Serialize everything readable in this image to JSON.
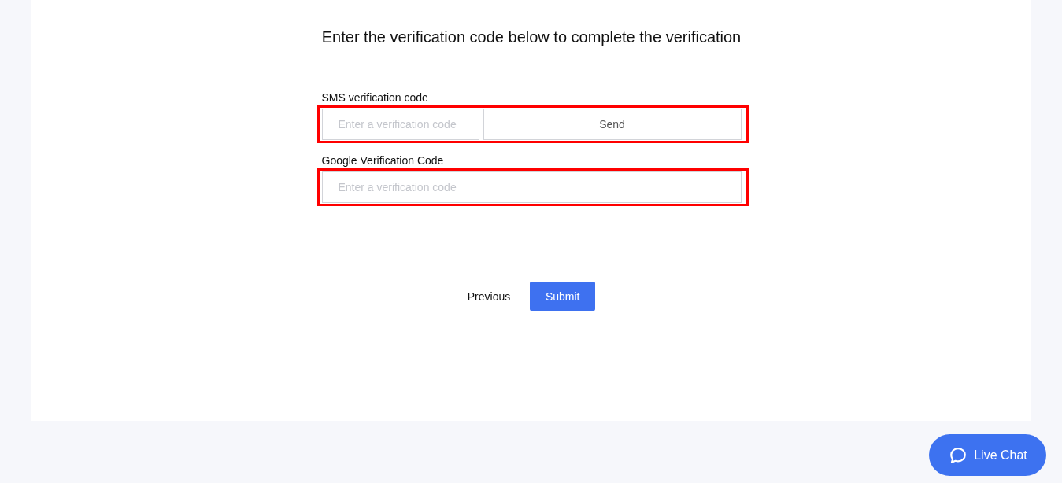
{
  "heading": "Enter the verification code below to complete the verification",
  "fields": [
    {
      "kind": "code_with_send",
      "label": "SMS verification code",
      "placeholder": "Enter a verification code",
      "button": "Send",
      "highlighted": true
    },
    {
      "kind": "code",
      "label": "Google Verification Code",
      "placeholder": "Enter a verification code",
      "highlighted": true
    }
  ],
  "actions": {
    "previous": "Previous",
    "submit": "Submit"
  },
  "live_chat": {
    "label": "Live Chat"
  }
}
